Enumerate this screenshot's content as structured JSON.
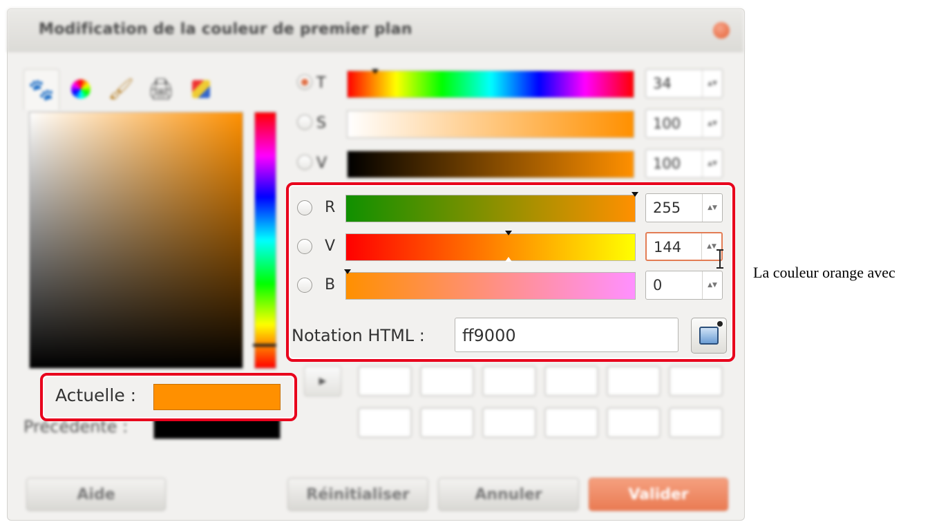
{
  "dialog": {
    "title": "Modification de la couleur de premier plan",
    "tabs": [
      "gimp-icon",
      "color-wheel-icon",
      "brush-icon",
      "printer-icon",
      "palette-icon"
    ]
  },
  "hsv": [
    {
      "label": "T",
      "value": "34",
      "selected": true
    },
    {
      "label": "S",
      "value": "100",
      "selected": false
    },
    {
      "label": "V",
      "value": "100",
      "selected": false
    }
  ],
  "rgb": [
    {
      "label": "R",
      "value": "255",
      "selected": false
    },
    {
      "label": "V",
      "value": "144",
      "selected": false
    },
    {
      "label": "B",
      "value": "0",
      "selected": false
    }
  ],
  "html_notation": {
    "label": "Notation HTML :",
    "value": "ff9000"
  },
  "current": {
    "label": "Actuelle :",
    "color": "#ff9000"
  },
  "previous": {
    "label": "Précédente :",
    "color": "#000000"
  },
  "buttons": {
    "help": "Aide",
    "reset": "Réinitialiser",
    "cancel": "Annuler",
    "ok": "Valider"
  },
  "caption": "La couleur orange avec"
}
